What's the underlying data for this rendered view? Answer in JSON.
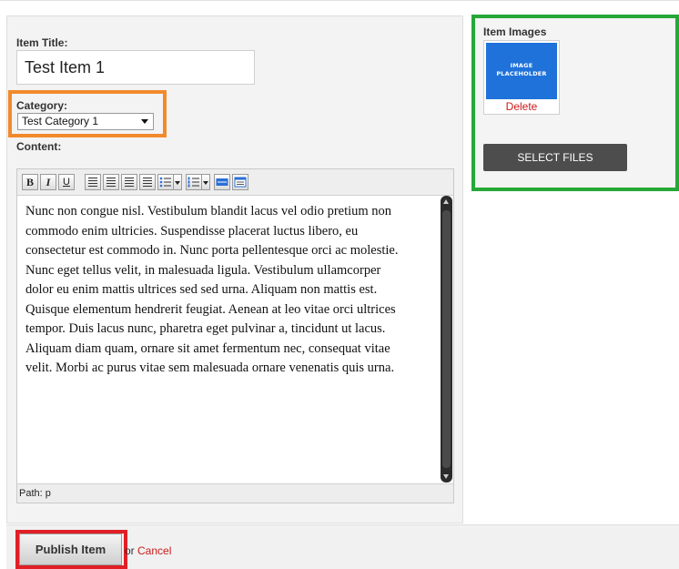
{
  "form": {
    "title_label": "Item Title:",
    "title_value": "Test Item 1",
    "category_label": "Category:",
    "category_selected": "Test Category 1",
    "content_label": "Content:"
  },
  "editor": {
    "toolbar": {
      "bold": "B",
      "italic": "I",
      "underline": "U"
    },
    "content_lines": [
      "Nunc non congue nisl. Vestibulum blandit lacus vel odio pretium non",
      "commodo enim ultricies. Suspendisse placerat luctus libero, eu",
      "consectetur est commodo in. Nunc porta pellentesque orci ac molestie.",
      "Nunc eget tellus velit, in malesuada ligula. Vestibulum ullamcorper",
      "dolor eu enim mattis ultrices sed sed urna. Aliquam non mattis est.",
      "Quisque elementum hendrerit feugiat. Aenean at leo vitae orci ultrices",
      "tempor. Duis lacus nunc, pharetra eget pulvinar a, tincidunt ut lacus.",
      "Aliquam diam quam, ornare sit amet fermentum nec, consequat vitae",
      "velit. Morbi ac purus vitae sem malesuada ornare venenatis quis urna."
    ],
    "path_label": "Path: p"
  },
  "images": {
    "label": "Item Images",
    "placeholder_line1": "IMAGE",
    "placeholder_line2": "PLACEHOLDER",
    "delete_label": "Delete",
    "select_files_label": "SELECT FILES"
  },
  "actions": {
    "publish_label": "Publish Item",
    "or_text": "or",
    "cancel_label": "Cancel"
  },
  "colors": {
    "category_highlight": "#f28a2c",
    "images_highlight": "#25a838",
    "publish_highlight": "#e01f26",
    "link_red": "#cc1a1a",
    "placeholder_blue": "#1f72d9"
  }
}
